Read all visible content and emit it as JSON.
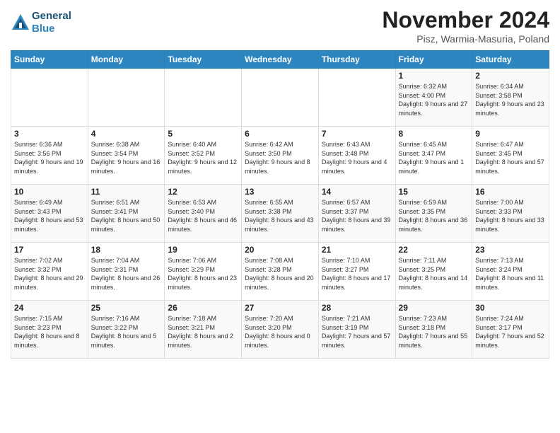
{
  "header": {
    "logo_general": "General",
    "logo_blue": "Blue",
    "title": "November 2024",
    "subtitle": "Pisz, Warmia-Masuria, Poland"
  },
  "days_of_week": [
    "Sunday",
    "Monday",
    "Tuesday",
    "Wednesday",
    "Thursday",
    "Friday",
    "Saturday"
  ],
  "weeks": [
    [
      {
        "day": "",
        "info": ""
      },
      {
        "day": "",
        "info": ""
      },
      {
        "day": "",
        "info": ""
      },
      {
        "day": "",
        "info": ""
      },
      {
        "day": "",
        "info": ""
      },
      {
        "day": "1",
        "info": "Sunrise: 6:32 AM\nSunset: 4:00 PM\nDaylight: 9 hours and 27 minutes."
      },
      {
        "day": "2",
        "info": "Sunrise: 6:34 AM\nSunset: 3:58 PM\nDaylight: 9 hours and 23 minutes."
      }
    ],
    [
      {
        "day": "3",
        "info": "Sunrise: 6:36 AM\nSunset: 3:56 PM\nDaylight: 9 hours and 19 minutes."
      },
      {
        "day": "4",
        "info": "Sunrise: 6:38 AM\nSunset: 3:54 PM\nDaylight: 9 hours and 16 minutes."
      },
      {
        "day": "5",
        "info": "Sunrise: 6:40 AM\nSunset: 3:52 PM\nDaylight: 9 hours and 12 minutes."
      },
      {
        "day": "6",
        "info": "Sunrise: 6:42 AM\nSunset: 3:50 PM\nDaylight: 9 hours and 8 minutes."
      },
      {
        "day": "7",
        "info": "Sunrise: 6:43 AM\nSunset: 3:48 PM\nDaylight: 9 hours and 4 minutes."
      },
      {
        "day": "8",
        "info": "Sunrise: 6:45 AM\nSunset: 3:47 PM\nDaylight: 9 hours and 1 minute."
      },
      {
        "day": "9",
        "info": "Sunrise: 6:47 AM\nSunset: 3:45 PM\nDaylight: 8 hours and 57 minutes."
      }
    ],
    [
      {
        "day": "10",
        "info": "Sunrise: 6:49 AM\nSunset: 3:43 PM\nDaylight: 8 hours and 53 minutes."
      },
      {
        "day": "11",
        "info": "Sunrise: 6:51 AM\nSunset: 3:41 PM\nDaylight: 8 hours and 50 minutes."
      },
      {
        "day": "12",
        "info": "Sunrise: 6:53 AM\nSunset: 3:40 PM\nDaylight: 8 hours and 46 minutes."
      },
      {
        "day": "13",
        "info": "Sunrise: 6:55 AM\nSunset: 3:38 PM\nDaylight: 8 hours and 43 minutes."
      },
      {
        "day": "14",
        "info": "Sunrise: 6:57 AM\nSunset: 3:37 PM\nDaylight: 8 hours and 39 minutes."
      },
      {
        "day": "15",
        "info": "Sunrise: 6:59 AM\nSunset: 3:35 PM\nDaylight: 8 hours and 36 minutes."
      },
      {
        "day": "16",
        "info": "Sunrise: 7:00 AM\nSunset: 3:33 PM\nDaylight: 8 hours and 33 minutes."
      }
    ],
    [
      {
        "day": "17",
        "info": "Sunrise: 7:02 AM\nSunset: 3:32 PM\nDaylight: 8 hours and 29 minutes."
      },
      {
        "day": "18",
        "info": "Sunrise: 7:04 AM\nSunset: 3:31 PM\nDaylight: 8 hours and 26 minutes."
      },
      {
        "day": "19",
        "info": "Sunrise: 7:06 AM\nSunset: 3:29 PM\nDaylight: 8 hours and 23 minutes."
      },
      {
        "day": "20",
        "info": "Sunrise: 7:08 AM\nSunset: 3:28 PM\nDaylight: 8 hours and 20 minutes."
      },
      {
        "day": "21",
        "info": "Sunrise: 7:10 AM\nSunset: 3:27 PM\nDaylight: 8 hours and 17 minutes."
      },
      {
        "day": "22",
        "info": "Sunrise: 7:11 AM\nSunset: 3:25 PM\nDaylight: 8 hours and 14 minutes."
      },
      {
        "day": "23",
        "info": "Sunrise: 7:13 AM\nSunset: 3:24 PM\nDaylight: 8 hours and 11 minutes."
      }
    ],
    [
      {
        "day": "24",
        "info": "Sunrise: 7:15 AM\nSunset: 3:23 PM\nDaylight: 8 hours and 8 minutes."
      },
      {
        "day": "25",
        "info": "Sunrise: 7:16 AM\nSunset: 3:22 PM\nDaylight: 8 hours and 5 minutes."
      },
      {
        "day": "26",
        "info": "Sunrise: 7:18 AM\nSunset: 3:21 PM\nDaylight: 8 hours and 2 minutes."
      },
      {
        "day": "27",
        "info": "Sunrise: 7:20 AM\nSunset: 3:20 PM\nDaylight: 8 hours and 0 minutes."
      },
      {
        "day": "28",
        "info": "Sunrise: 7:21 AM\nSunset: 3:19 PM\nDaylight: 7 hours and 57 minutes."
      },
      {
        "day": "29",
        "info": "Sunrise: 7:23 AM\nSunset: 3:18 PM\nDaylight: 7 hours and 55 minutes."
      },
      {
        "day": "30",
        "info": "Sunrise: 7:24 AM\nSunset: 3:17 PM\nDaylight: 7 hours and 52 minutes."
      }
    ]
  ]
}
